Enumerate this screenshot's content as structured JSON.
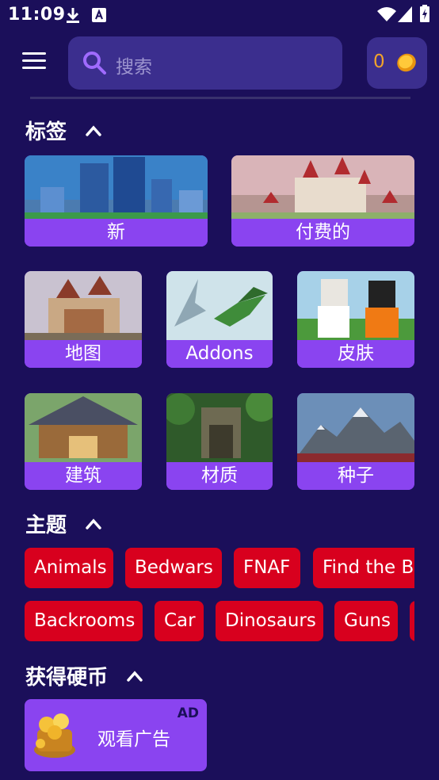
{
  "status_bar": {
    "time": "11:09"
  },
  "search": {
    "placeholder": "搜索"
  },
  "coins": {
    "count": "0"
  },
  "tags_section": {
    "title": "标签",
    "items": [
      {
        "label": "新"
      },
      {
        "label": "付费的"
      },
      {
        "label": "地图"
      },
      {
        "label": "Addons"
      },
      {
        "label": "皮肤"
      },
      {
        "label": "建筑"
      },
      {
        "label": "材质"
      },
      {
        "label": "种子"
      }
    ]
  },
  "themes_section": {
    "title": "主题",
    "row1": [
      "Animals",
      "Bedwars",
      "FNAF",
      "Find the B"
    ],
    "row2": [
      "Backrooms",
      "Car",
      "Dinosaurs",
      "Guns"
    ]
  },
  "earn_section": {
    "title": "获得硬币",
    "ad_card_label": "观看广告",
    "ad_badge": "AD"
  },
  "colors": {
    "background": "#1b0f5a",
    "accent_purple": "#8a44f0",
    "chip_red": "#d8001e",
    "coin": "#f2a32a"
  }
}
